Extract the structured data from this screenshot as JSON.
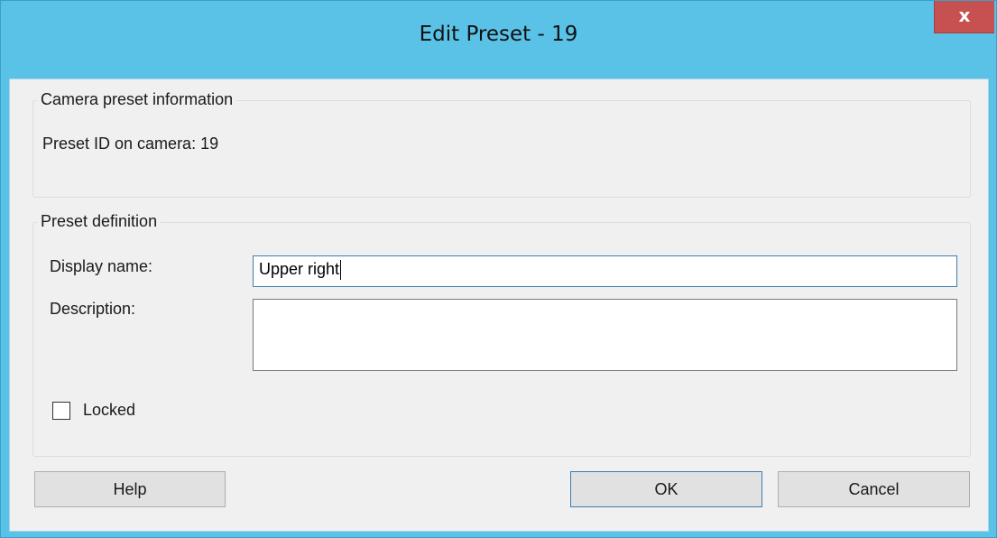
{
  "window": {
    "title": "Edit Preset - 19",
    "close_glyph": "x"
  },
  "camera_info": {
    "legend": "Camera preset information",
    "preset_id_text": "Preset ID on camera: 19"
  },
  "preset_definition": {
    "legend": "Preset definition",
    "display_name_label": "Display name:",
    "display_name_value": "Upper right",
    "description_label": "Description:",
    "description_value": "",
    "locked_label": "Locked",
    "locked_checked": false
  },
  "buttons": {
    "help": "Help",
    "ok": "OK",
    "cancel": "Cancel"
  },
  "colors": {
    "titlebar": "#5bc2e7",
    "close_button": "#c75050",
    "client_background": "#f0f0f0",
    "focus_border": "#3c7fb1"
  }
}
